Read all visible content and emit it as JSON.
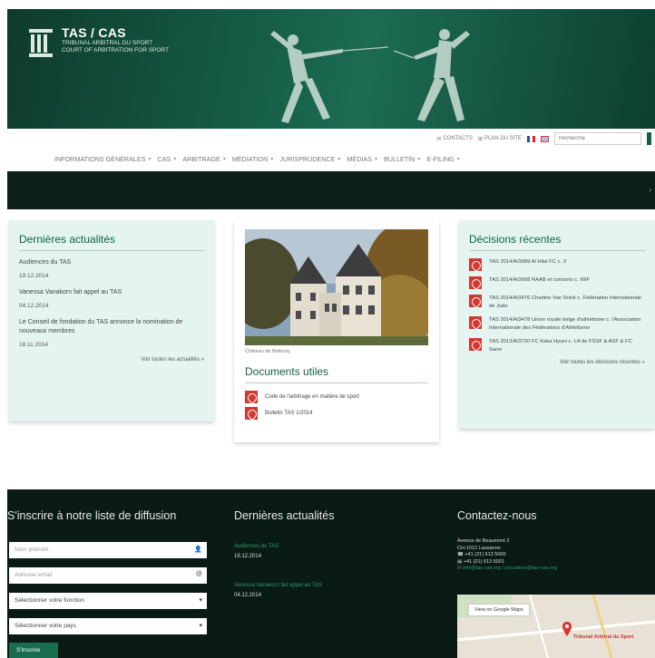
{
  "header": {
    "brand": "TAS / CAS",
    "subtitle_1": "TRIBUNAL ARBITRAL DU SPORT",
    "subtitle_2": "COURT OF ARBITRATION FOR SPORT"
  },
  "utility": {
    "contact": "CONTACTS",
    "sitemap": "PLAN DU SITE",
    "search_placeholder": "Recherche"
  },
  "nav": [
    "INFORMATIONS GÉNÉRALES",
    "CAS",
    "ARBITRAGE",
    "MÉDIATION",
    "JURISPRUDENCE",
    "MÉDIAS",
    "BULLETIN",
    "E-FILING"
  ],
  "news_panel": {
    "title": "Dernières actualités",
    "items": [
      {
        "title": "Audiences du TAS",
        "date": "19.12.2014"
      },
      {
        "title": "Vanessa Vanakorn fait appel au TAS",
        "date": "04.12.2014"
      },
      {
        "title": "Le Conseil de fondation du TAS annonce la nomination de nouveaux membres",
        "date": "18.11.2014"
      }
    ],
    "more": "Voir toutes les actualités »"
  },
  "center": {
    "caption": "Château de Béthusy",
    "docs_title": "Documents utiles",
    "docs": [
      "Code de l'arbitrage en matière de sport",
      "Bulletin TAS 1/2014"
    ]
  },
  "decisions_panel": {
    "title": "Décisions récentes",
    "items": [
      "TAS 2014/A/3689 Al Hilal FC c. X",
      "TAS 2014/A/3668 RAAB et consorts c. IWF",
      "TAS 2014/A/3476 Charline Van Snick c. Fédération Internationale de Judo",
      "TAS 2014/A/3478 Union royale belge d'athlétisme c. l'Association Internationale des Fédérations d'Athlétisme",
      "TAS 2013/A/3720 FC Kaka Hyuni c. LA de FSSF & ASF & FC Sarre"
    ],
    "more": "Voir toutes les décisions récentes »"
  },
  "footer": {
    "subscribe_title": "S'inscrire à notre liste de diffusion",
    "name_placeholder": "Nom prénom",
    "email_placeholder": "Adresse email",
    "function_select": "Sélectionner votre fonction",
    "country_select": "Sélectionner votre pays",
    "subscribe_button": "S'inscrire",
    "news_title": "Dernières actualités",
    "news": [
      {
        "title": "Audiences du TAS",
        "date": "19.12.2014"
      },
      {
        "title": "Vanessa Vanakorn fait appel au TAS",
        "date": "04.12.2014"
      }
    ],
    "contact_title": "Contactez-nous",
    "contact_lines": [
      "Avenue de Beaumont 2",
      "CH-1012 Lausanne",
      "+41 (21) 613 5000",
      "+41 (21) 613 5001"
    ],
    "contact_email": "info@tas-cas.org / procedure@tas-cas.org",
    "map_button": "View on Google Maps",
    "map_label": "Tribunal Arbitral du Sport"
  },
  "colors": {
    "brand_green": "#146045",
    "panel_bg": "#e4f5f1",
    "footer_bg": "#0a1a14",
    "pdf_red": "#d13a33"
  },
  "icons": [
    "logo-pillars-icon",
    "contact-icon",
    "sitemap-icon",
    "flag-fr-icon",
    "flag-en-icon",
    "pdf-icon",
    "user-icon",
    "at-icon",
    "caret-down-icon",
    "map-pin-icon"
  ]
}
